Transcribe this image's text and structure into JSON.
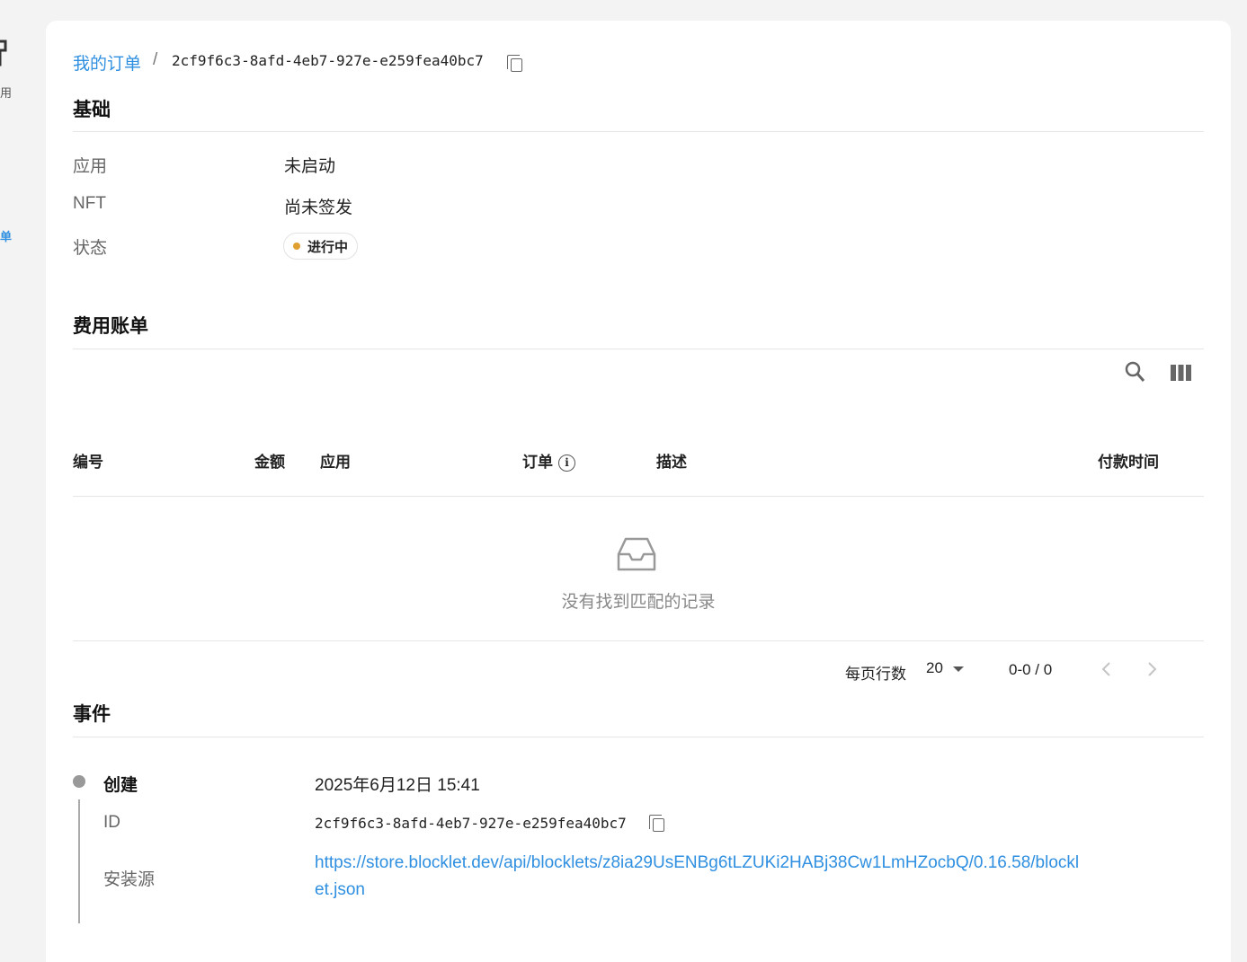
{
  "sidebar": {
    "items": [
      {
        "label": "用",
        "icon": "app-icon"
      },
      {
        "label": "单",
        "icon": "list-icon"
      }
    ]
  },
  "breadcrumb": {
    "link": "我的订单",
    "separator": "/",
    "order_id": "2cf9f6c3-8afd-4eb7-927e-e259fea40bc7"
  },
  "basic": {
    "title": "基础",
    "fields": [
      {
        "label": "应用",
        "value": "未启动"
      },
      {
        "label": "NFT",
        "value": "尚未签发"
      },
      {
        "label": "状态",
        "value": "进行中"
      }
    ],
    "status_color": "#e0a030"
  },
  "billing": {
    "title": "费用账单",
    "columns": [
      "编号",
      "金额",
      "应用",
      "订单",
      "描述",
      "付款时间"
    ],
    "empty_text": "没有找到匹配的记录",
    "pager": {
      "rows_per_page_label": "每页行数",
      "rows_per_page": "20",
      "range": "0-0 / 0"
    }
  },
  "events": {
    "title": "事件",
    "items": [
      {
        "name": "创建",
        "time": "2025年6月12日 15:41",
        "id_label": "ID",
        "id_value": "2cf9f6c3-8afd-4eb7-927e-e259fea40bc7",
        "source_label": "安装源",
        "source_line1": "https://store.blocklet.dev/api/blocklets/z8ia29UsENBg6tLZUKi2HABj38Cw1LmHZocbQ/0.16.58/blockl",
        "source_line2": "et.json"
      }
    ]
  },
  "colors": {
    "accent": "#2f8fe0",
    "background": "#f3f3f3"
  }
}
